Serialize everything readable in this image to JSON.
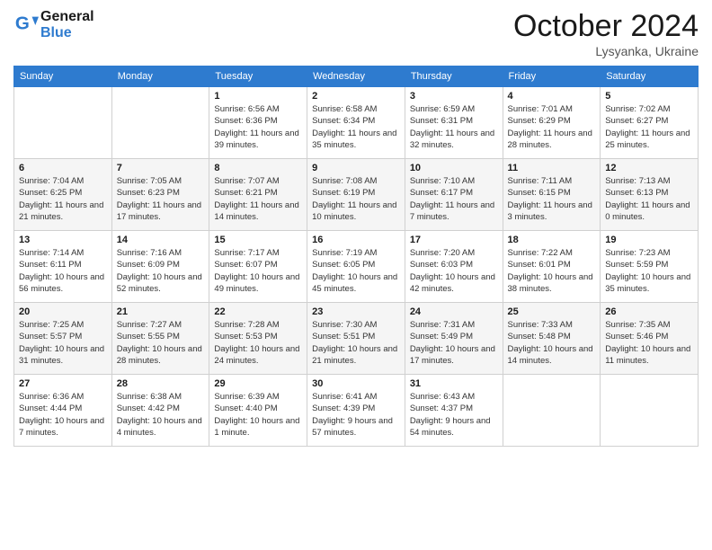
{
  "header": {
    "logo_line1": "General",
    "logo_line2": "Blue",
    "month": "October 2024",
    "location": "Lysyanka, Ukraine"
  },
  "weekdays": [
    "Sunday",
    "Monday",
    "Tuesday",
    "Wednesday",
    "Thursday",
    "Friday",
    "Saturday"
  ],
  "weeks": [
    [
      {
        "day": "",
        "info": ""
      },
      {
        "day": "",
        "info": ""
      },
      {
        "day": "1",
        "info": "Sunrise: 6:56 AM\nSunset: 6:36 PM\nDaylight: 11 hours and 39 minutes."
      },
      {
        "day": "2",
        "info": "Sunrise: 6:58 AM\nSunset: 6:34 PM\nDaylight: 11 hours and 35 minutes."
      },
      {
        "day": "3",
        "info": "Sunrise: 6:59 AM\nSunset: 6:31 PM\nDaylight: 11 hours and 32 minutes."
      },
      {
        "day": "4",
        "info": "Sunrise: 7:01 AM\nSunset: 6:29 PM\nDaylight: 11 hours and 28 minutes."
      },
      {
        "day": "5",
        "info": "Sunrise: 7:02 AM\nSunset: 6:27 PM\nDaylight: 11 hours and 25 minutes."
      }
    ],
    [
      {
        "day": "6",
        "info": "Sunrise: 7:04 AM\nSunset: 6:25 PM\nDaylight: 11 hours and 21 minutes."
      },
      {
        "day": "7",
        "info": "Sunrise: 7:05 AM\nSunset: 6:23 PM\nDaylight: 11 hours and 17 minutes."
      },
      {
        "day": "8",
        "info": "Sunrise: 7:07 AM\nSunset: 6:21 PM\nDaylight: 11 hours and 14 minutes."
      },
      {
        "day": "9",
        "info": "Sunrise: 7:08 AM\nSunset: 6:19 PM\nDaylight: 11 hours and 10 minutes."
      },
      {
        "day": "10",
        "info": "Sunrise: 7:10 AM\nSunset: 6:17 PM\nDaylight: 11 hours and 7 minutes."
      },
      {
        "day": "11",
        "info": "Sunrise: 7:11 AM\nSunset: 6:15 PM\nDaylight: 11 hours and 3 minutes."
      },
      {
        "day": "12",
        "info": "Sunrise: 7:13 AM\nSunset: 6:13 PM\nDaylight: 11 hours and 0 minutes."
      }
    ],
    [
      {
        "day": "13",
        "info": "Sunrise: 7:14 AM\nSunset: 6:11 PM\nDaylight: 10 hours and 56 minutes."
      },
      {
        "day": "14",
        "info": "Sunrise: 7:16 AM\nSunset: 6:09 PM\nDaylight: 10 hours and 52 minutes."
      },
      {
        "day": "15",
        "info": "Sunrise: 7:17 AM\nSunset: 6:07 PM\nDaylight: 10 hours and 49 minutes."
      },
      {
        "day": "16",
        "info": "Sunrise: 7:19 AM\nSunset: 6:05 PM\nDaylight: 10 hours and 45 minutes."
      },
      {
        "day": "17",
        "info": "Sunrise: 7:20 AM\nSunset: 6:03 PM\nDaylight: 10 hours and 42 minutes."
      },
      {
        "day": "18",
        "info": "Sunrise: 7:22 AM\nSunset: 6:01 PM\nDaylight: 10 hours and 38 minutes."
      },
      {
        "day": "19",
        "info": "Sunrise: 7:23 AM\nSunset: 5:59 PM\nDaylight: 10 hours and 35 minutes."
      }
    ],
    [
      {
        "day": "20",
        "info": "Sunrise: 7:25 AM\nSunset: 5:57 PM\nDaylight: 10 hours and 31 minutes."
      },
      {
        "day": "21",
        "info": "Sunrise: 7:27 AM\nSunset: 5:55 PM\nDaylight: 10 hours and 28 minutes."
      },
      {
        "day": "22",
        "info": "Sunrise: 7:28 AM\nSunset: 5:53 PM\nDaylight: 10 hours and 24 minutes."
      },
      {
        "day": "23",
        "info": "Sunrise: 7:30 AM\nSunset: 5:51 PM\nDaylight: 10 hours and 21 minutes."
      },
      {
        "day": "24",
        "info": "Sunrise: 7:31 AM\nSunset: 5:49 PM\nDaylight: 10 hours and 17 minutes."
      },
      {
        "day": "25",
        "info": "Sunrise: 7:33 AM\nSunset: 5:48 PM\nDaylight: 10 hours and 14 minutes."
      },
      {
        "day": "26",
        "info": "Sunrise: 7:35 AM\nSunset: 5:46 PM\nDaylight: 10 hours and 11 minutes."
      }
    ],
    [
      {
        "day": "27",
        "info": "Sunrise: 6:36 AM\nSunset: 4:44 PM\nDaylight: 10 hours and 7 minutes."
      },
      {
        "day": "28",
        "info": "Sunrise: 6:38 AM\nSunset: 4:42 PM\nDaylight: 10 hours and 4 minutes."
      },
      {
        "day": "29",
        "info": "Sunrise: 6:39 AM\nSunset: 4:40 PM\nDaylight: 10 hours and 1 minute."
      },
      {
        "day": "30",
        "info": "Sunrise: 6:41 AM\nSunset: 4:39 PM\nDaylight: 9 hours and 57 minutes."
      },
      {
        "day": "31",
        "info": "Sunrise: 6:43 AM\nSunset: 4:37 PM\nDaylight: 9 hours and 54 minutes."
      },
      {
        "day": "",
        "info": ""
      },
      {
        "day": "",
        "info": ""
      }
    ]
  ]
}
